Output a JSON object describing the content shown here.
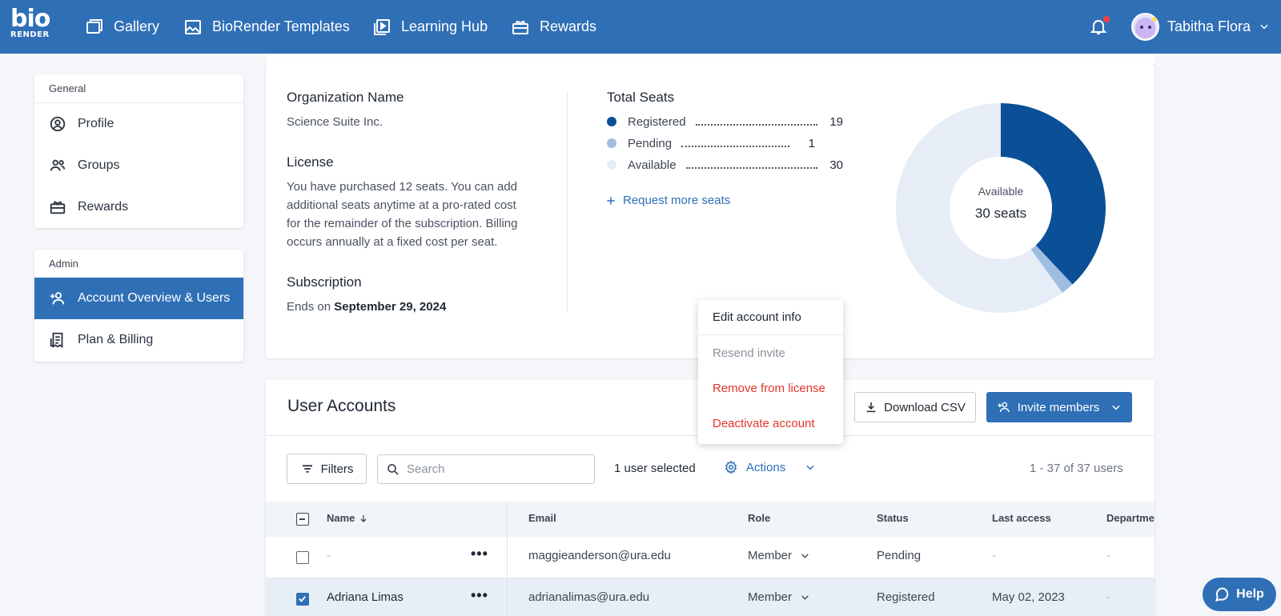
{
  "brand": {
    "logo_top": "bio",
    "logo_bottom": "RENDER"
  },
  "nav": {
    "items": [
      {
        "label": "Gallery",
        "icon": "gallery-icon"
      },
      {
        "label": "BioRender Templates",
        "icon": "image-icon"
      },
      {
        "label": "Learning Hub",
        "icon": "play-icon"
      },
      {
        "label": "Rewards",
        "icon": "gift-icon"
      }
    ],
    "user_name": "Tabitha Flora"
  },
  "sidebar": {
    "general_heading": "General",
    "general_items": [
      {
        "label": "Profile",
        "icon": "profile-icon"
      },
      {
        "label": "Groups",
        "icon": "groups-icon"
      },
      {
        "label": "Rewards",
        "icon": "gift-icon"
      }
    ],
    "admin_heading": "Admin",
    "admin_items": [
      {
        "label": "Account Overview & Users",
        "icon": "add-user-icon",
        "active": true
      },
      {
        "label": "Plan & Billing",
        "icon": "receipt-icon",
        "active": false
      }
    ]
  },
  "org": {
    "name_label": "Organization Name",
    "name_value": "Science Suite Inc.",
    "license_label": "License",
    "license_text_lines": [
      "You have purchased 12 seats. You can add",
      "additional seats anytime at a pro-rated cost",
      "for the remainder of the subscription. Billing",
      "occurs annually at a fixed cost per seat."
    ],
    "subscription_label": "Subscription",
    "subscription_prefix": "Ends on",
    "subscription_date": "September 29, 2024"
  },
  "seats": {
    "title": "Total Seats",
    "rows": [
      {
        "label": "Registered",
        "value": "19",
        "color": "#0b4f97"
      },
      {
        "label": "Pending",
        "value": "1",
        "color": "#9ebde0"
      },
      {
        "label": "Available",
        "value": "30",
        "color": "#e6edf6"
      }
    ],
    "request_label": "Request more seats",
    "donut_caption": "Available",
    "donut_value": "30 seats"
  },
  "chart_data": {
    "type": "pie",
    "categories": [
      "Registered",
      "Pending",
      "Available"
    ],
    "values": [
      19,
      1,
      30
    ],
    "colors": [
      "#0b4f97",
      "#9ebde0",
      "#e6edf6"
    ]
  },
  "actions_menu": {
    "items": [
      {
        "label": "Edit account info",
        "color": "#1f2733"
      },
      {
        "label": "Resend invite",
        "color": "#8a919c"
      },
      {
        "label": "Remove from license",
        "color": "#e5332a"
      },
      {
        "label": "Deactivate account",
        "color": "#e5332a"
      }
    ]
  },
  "users": {
    "title": "User Accounts",
    "download_label": "Download CSV",
    "invite_label": "Invite members",
    "filters_label": "Filters",
    "search_placeholder": "Search",
    "selected_text": "1 user selected",
    "actions_label": "Actions",
    "pagination": "1 - 37 of 37 users",
    "columns": [
      "Name",
      "Email",
      "Role",
      "Status",
      "Last access",
      "Departmen"
    ],
    "rows": [
      {
        "name": "-",
        "email": "maggieanderson@ura.edu",
        "role": "Member",
        "status": "Pending",
        "last_access": "-",
        "department": "-",
        "checked": false
      },
      {
        "name": "Adriana Limas",
        "email": "adrianalimas@ura.edu",
        "role": "Member",
        "status": "Registered",
        "last_access": "May 02, 2023",
        "department": "-",
        "checked": true
      }
    ]
  },
  "help": {
    "label": "Help"
  }
}
